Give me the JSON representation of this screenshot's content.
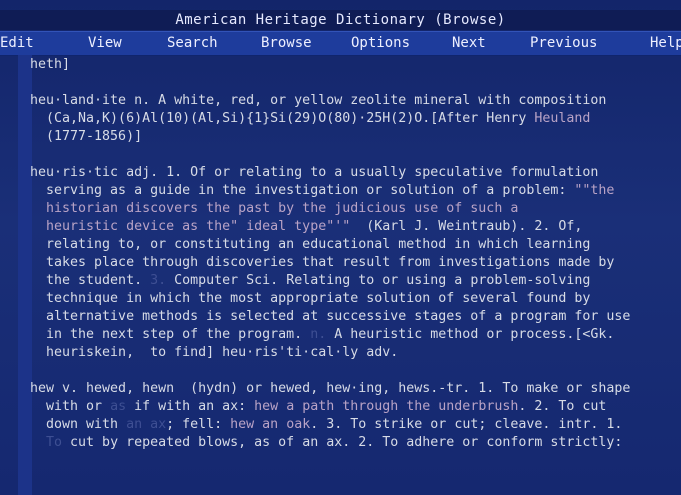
{
  "app": {
    "title": "American Heritage Dictionary  (Browse)"
  },
  "menu": {
    "items": [
      {
        "key": "edit",
        "label": "Edit"
      },
      {
        "key": "view",
        "label": "View"
      },
      {
        "key": "search",
        "label": "Search"
      },
      {
        "key": "browse",
        "label": "Browse"
      },
      {
        "key": "options",
        "label": "Options"
      },
      {
        "key": "next",
        "label": "Next"
      },
      {
        "key": "previous",
        "label": "Previous"
      },
      {
        "key": "help",
        "label": "Help"
      }
    ]
  },
  "entries": [
    {
      "lines": [
        [
          {
            "t": "heth]"
          }
        ]
      ]
    },
    {
      "lines": [
        [
          {
            "t": "heu·land·ite n. A white, red, or yellow zeolite mineral with composition"
          }
        ],
        [
          {
            "t": "  (Ca,Na,K)(6)Al(10)(Al,Si){1}Si(29)O(80)·25H(2)O.[After Henry "
          },
          {
            "t": "Heuland",
            "h": true
          }
        ],
        [
          {
            "t": "  (1777-1856)]"
          }
        ]
      ]
    },
    {
      "lines": [
        [
          {
            "t": "heu·ris·tic adj. 1. Of or relating to a usually speculative formulation"
          }
        ],
        [
          {
            "t": "  serving as a guide in the investigation or solution of a problem: "
          },
          {
            "t": "\"\"the",
            "h": true
          }
        ],
        [
          {
            "t": "  historian discovers the past by the judicious use of such a",
            "h": true
          }
        ],
        [
          {
            "t": "  heuristic device as the\" ideal type\"'\"",
            "h": true
          },
          {
            "t": "  (Karl J. Weintraub). 2. Of,"
          }
        ],
        [
          {
            "t": "  relating to, or constituting an educational method in which learning"
          }
        ],
        [
          {
            "t": "  takes place through discoveries that result from investigations made by"
          }
        ],
        [
          {
            "t": "  the student. "
          },
          {
            "t": "3.",
            "d": true
          },
          {
            "t": " Computer Sci. Relating to or using a problem-solving"
          }
        ],
        [
          {
            "t": "  technique in which the most appropriate solution of several found by"
          }
        ],
        [
          {
            "t": "  alternative methods is selected at successive stages of a program for use"
          }
        ],
        [
          {
            "t": "  in the next step of the program. "
          },
          {
            "t": "n.",
            "d": true
          },
          {
            "t": " A heuristic method or process.[<Gk."
          }
        ],
        [
          {
            "t": "  heuriskein,  to find] heu·ris'ti·cal·ly adv."
          }
        ]
      ]
    },
    {
      "lines": [
        [
          {
            "t": "hew v. hewed, hewn  (hydn) or hewed, hew·ing, hews.-tr. 1. To make or shape"
          }
        ],
        [
          {
            "t": "  with or "
          },
          {
            "t": "as",
            "d": true
          },
          {
            "t": " if with an ax: "
          },
          {
            "t": "hew a path through the underbrush",
            "h": true
          },
          {
            "t": ". 2. To cut"
          }
        ],
        [
          {
            "t": "  down with "
          },
          {
            "t": "an ax",
            "d": true
          },
          {
            "t": "; fell: "
          },
          {
            "t": "hew an oak",
            "h": true
          },
          {
            "t": ". 3. To strike or cut; cleave. intr. 1."
          }
        ],
        [
          {
            "t": "  "
          },
          {
            "t": "To",
            "d": true
          },
          {
            "t": " cut by repeated blows, as of an ax. 2. To adhere or conform strictly:"
          }
        ]
      ]
    }
  ]
}
